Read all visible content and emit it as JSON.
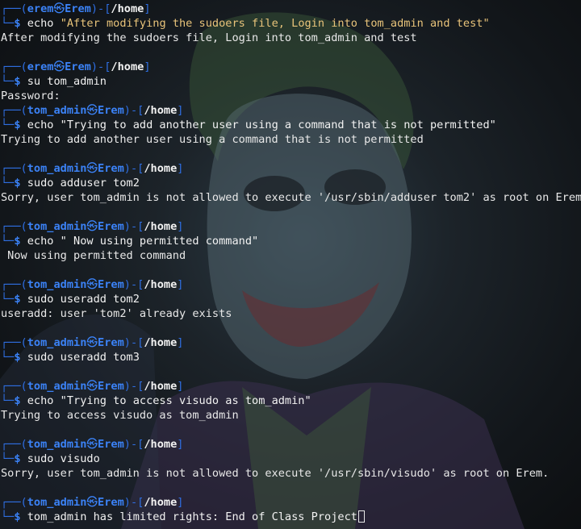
{
  "terminal": {
    "prompt_dir": "/home",
    "skull_glyph": "㉿",
    "entries": [
      {
        "user": "erem",
        "host": "Erem",
        "command": "echo",
        "arg_string": "\"After modifying the sudoers file, Login into tom_admin and test\"",
        "output": [
          "After modifying the sudoers file, Login into tom_admin and test"
        ]
      },
      {
        "user": "erem",
        "host": "Erem",
        "command": "su tom_admin",
        "arg_string": "",
        "output": [
          "Password:"
        ]
      },
      {
        "user": "tom_admin",
        "host": "Erem",
        "command": "echo \"Trying to add another user using a command that is not permitted\"",
        "arg_string": "",
        "output": [
          "Trying to add another user using a command that is not permitted"
        ]
      },
      {
        "user": "tom_admin",
        "host": "Erem",
        "command": "sudo adduser tom2",
        "arg_string": "",
        "output": [
          "Sorry, user tom_admin is not allowed to execute '/usr/sbin/adduser tom2' as root on Erem."
        ]
      },
      {
        "user": "tom_admin",
        "host": "Erem",
        "command": "echo \" Now using permitted command\"",
        "arg_string": "",
        "output": [
          " Now using permitted command"
        ]
      },
      {
        "user": "tom_admin",
        "host": "Erem",
        "command": "sudo useradd tom2",
        "arg_string": "",
        "output": [
          "useradd: user 'tom2' already exists"
        ]
      },
      {
        "user": "tom_admin",
        "host": "Erem",
        "command": "sudo useradd tom3",
        "arg_string": "",
        "output": []
      },
      {
        "user": "tom_admin",
        "host": "Erem",
        "command": "echo \"Trying to access visudo as tom_admin\"",
        "arg_string": "",
        "output": [
          "Trying to access visudo as tom_admin"
        ]
      },
      {
        "user": "tom_admin",
        "host": "Erem",
        "command": "sudo visudo",
        "arg_string": "",
        "output": [
          "Sorry, user tom_admin is not allowed to execute '/usr/sbin/visudo' as root on Erem."
        ]
      },
      {
        "user": "tom_admin",
        "host": "Erem",
        "command": "tom_admin has limited rights: End of Class Project",
        "arg_string": "",
        "output": [],
        "active": true
      }
    ]
  },
  "colors": {
    "frame": "#2f6fe3",
    "user": "#3b82f6",
    "string": "#e8c37a",
    "text": "#e8e8e8",
    "background": "#111417"
  }
}
